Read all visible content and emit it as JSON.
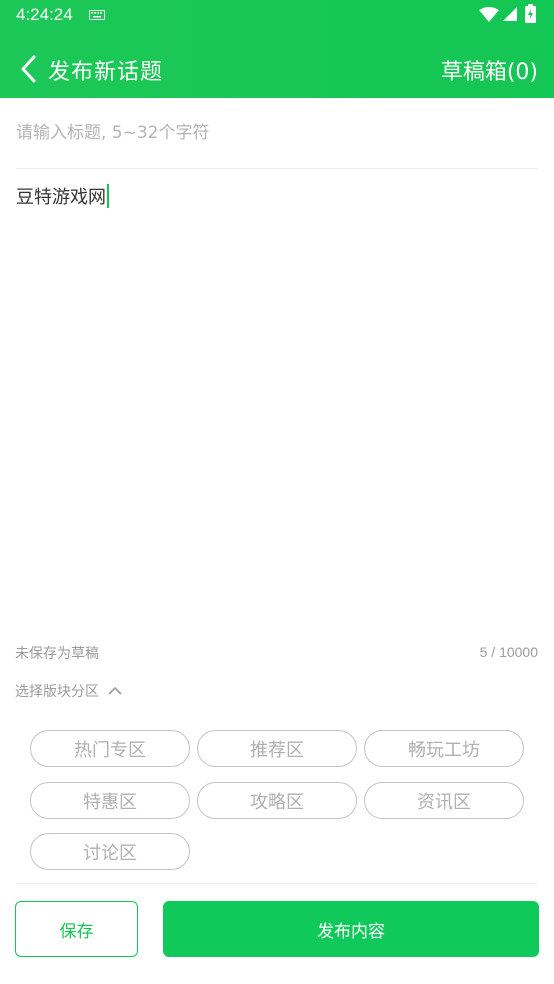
{
  "status_bar": {
    "time": "4:24:24",
    "icons": [
      "keyboard-icon",
      "wifi-icon",
      "signal-icon",
      "battery-charging-icon"
    ]
  },
  "header": {
    "back_icon": "chevron-left-icon",
    "title": "发布新话题",
    "drafts_label": "草稿箱(0)",
    "background_color": "#14c653"
  },
  "form": {
    "title_placeholder": "请输入标题, 5~32个字符",
    "title_value": "",
    "content_value": "豆特游戏网"
  },
  "footer_info": {
    "draft_status": "未保存为草稿",
    "char_count": "5 / 10000"
  },
  "sections": {
    "toggle_label": "选择版块分区",
    "toggle_icon": "chevron-up-icon",
    "chips": [
      {
        "label": "热门专区"
      },
      {
        "label": "推荐区"
      },
      {
        "label": "畅玩工坊"
      },
      {
        "label": "特惠区"
      },
      {
        "label": "攻略区"
      },
      {
        "label": "资讯区"
      },
      {
        "label": "讨论区"
      }
    ]
  },
  "actions": {
    "save_label": "保存",
    "publish_label": "发布内容",
    "accent_color": "#14c653"
  }
}
